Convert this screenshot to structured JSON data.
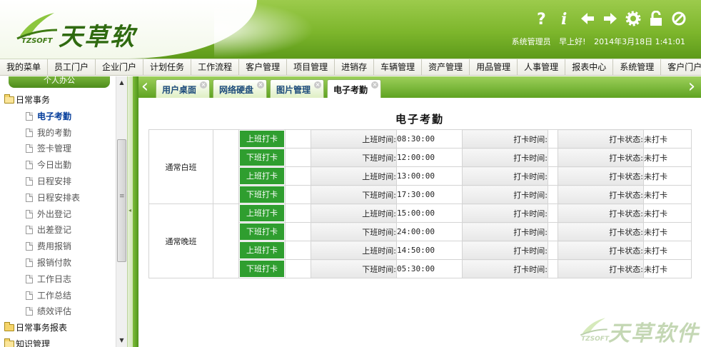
{
  "brand": {
    "name": "天草软件",
    "sub": "TZSOFT"
  },
  "header": {
    "icons": [
      "help-icon",
      "info-icon",
      "back-icon",
      "forward-icon",
      "settings-icon",
      "lock-icon",
      "logout-icon"
    ],
    "user": "系统管理员",
    "greeting": "早上好!",
    "datetime": "2014年3月18日 1:41:01"
  },
  "menu": [
    "我的菜单",
    "员工门户",
    "企业门户",
    "计划任务",
    "工作流程",
    "客户管理",
    "项目管理",
    "进销存",
    "车辆管理",
    "资产管理",
    "用品管理",
    "人事管理",
    "报表中心",
    "系统管理",
    "客户门户"
  ],
  "sidebar": {
    "title": "个人办公",
    "groups": [
      {
        "label": "日常事务",
        "open": true,
        "items": [
          "电子考勤",
          "我的考勤",
          "签卡管理",
          "今日出勤",
          "日程安排",
          "日程安排表",
          "外出登记",
          "出差登记",
          "费用报销",
          "报销付款",
          "工作日志",
          "工作总结",
          "绩效评估"
        ],
        "active": "电子考勤"
      },
      {
        "label": "日常事务报表",
        "open": false,
        "items": []
      },
      {
        "label": "知识管理",
        "open": true,
        "items": []
      }
    ]
  },
  "tabs": [
    {
      "label": "用户桌面",
      "active": false
    },
    {
      "label": "网络硬盘",
      "active": false
    },
    {
      "label": "图片管理",
      "active": false
    },
    {
      "label": "电子考勤",
      "active": true
    }
  ],
  "page": {
    "title": "电子考勤",
    "shifts": [
      {
        "name": "通常白班",
        "rows": [
          {
            "button": "上班打卡",
            "time_label": "上班时间:",
            "time": "08:30:00",
            "punch_label": "打卡时间:",
            "punch": "",
            "status_label": "打卡状态:",
            "status": "未打卡"
          },
          {
            "button": "下班打卡",
            "time_label": "下班时间:",
            "time": "12:00:00",
            "punch_label": "打卡时间:",
            "punch": "",
            "status_label": "打卡状态:",
            "status": "未打卡"
          },
          {
            "button": "上班打卡",
            "time_label": "上班时间:",
            "time": "13:00:00",
            "punch_label": "打卡时间:",
            "punch": "",
            "status_label": "打卡状态:",
            "status": "未打卡"
          },
          {
            "button": "下班打卡",
            "time_label": "下班时间:",
            "time": "17:30:00",
            "punch_label": "打卡时间:",
            "punch": "",
            "status_label": "打卡状态:",
            "status": "未打卡"
          }
        ]
      },
      {
        "name": "通常晚班",
        "rows": [
          {
            "button": "上班打卡",
            "time_label": "上班时间:",
            "time": "15:00:00",
            "punch_label": "打卡时间:",
            "punch": "",
            "status_label": "打卡状态:",
            "status": "未打卡"
          },
          {
            "button": "下班打卡",
            "time_label": "下班时间:",
            "time": "24:00:00",
            "punch_label": "打卡时间:",
            "punch": "",
            "status_label": "打卡状态:",
            "status": "未打卡"
          },
          {
            "button": "上班打卡",
            "time_label": "上班时间:",
            "time": "14:50:00",
            "punch_label": "打卡时间:",
            "punch": "",
            "status_label": "打卡状态:",
            "status": "未打卡"
          },
          {
            "button": "下班打卡",
            "time_label": "下班时间:",
            "time": "05:30:00",
            "punch_label": "打卡时间:",
            "punch": "",
            "status_label": "打卡状态:",
            "status": "未打卡"
          }
        ]
      }
    ]
  },
  "colors": {
    "accent": "#6aaa2a",
    "button": "#2f9e2f",
    "link_active": "#003a9a"
  }
}
